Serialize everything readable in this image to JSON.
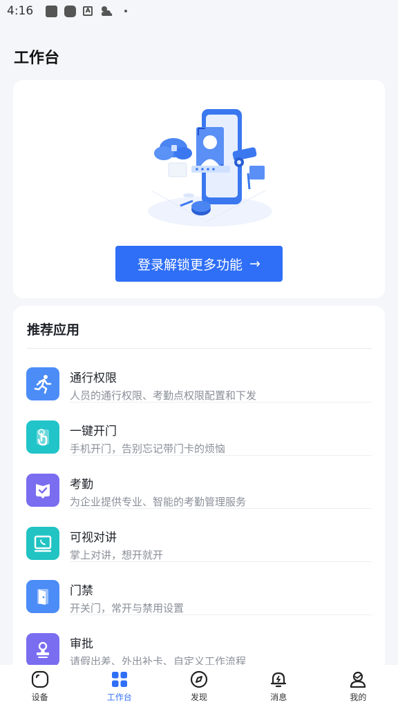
{
  "status_bar": {
    "time": "4:16"
  },
  "page": {
    "title": "工作台"
  },
  "hero": {
    "login_label": "登录解锁更多功能",
    "arrow": "→"
  },
  "recommended": {
    "title": "推荐应用",
    "items": [
      {
        "name": "通行权限",
        "desc": "人员的通行权限、考勤点权限配置和下发",
        "icon": "running-person-icon",
        "color": "#4b8cf7"
      },
      {
        "name": "一键开门",
        "desc": "手机开门，告别忘记带门卡的烦恼",
        "icon": "tap-hand-icon",
        "color": "#21c4c9"
      },
      {
        "name": "考勤",
        "desc": "为企业提供专业、智能的考勤管理服务",
        "icon": "shield-check-icon",
        "color": "#7a6df0"
      },
      {
        "name": "可视对讲",
        "desc": "掌上对讲，想开就开",
        "icon": "intercom-phone-icon",
        "color": "#22c3c3"
      },
      {
        "name": "门禁",
        "desc": "开关门，常开与禁用设置",
        "icon": "door-icon",
        "color": "#4b8cf7"
      },
      {
        "name": "审批",
        "desc": "请假出差、外出补卡、自定义工作流程",
        "icon": "stamp-icon",
        "color": "#7a6df0"
      }
    ]
  },
  "tabs": [
    {
      "label": "设备",
      "icon": "device-icon",
      "active": false
    },
    {
      "label": "工作台",
      "icon": "grid-icon",
      "active": true
    },
    {
      "label": "发现",
      "icon": "compass-icon",
      "active": false
    },
    {
      "label": "消息",
      "icon": "bell-icon",
      "active": false
    },
    {
      "label": "我的",
      "icon": "user-icon",
      "active": false
    }
  ],
  "colors": {
    "accent": "#2f6ff7",
    "background": "#f5f6f9"
  }
}
